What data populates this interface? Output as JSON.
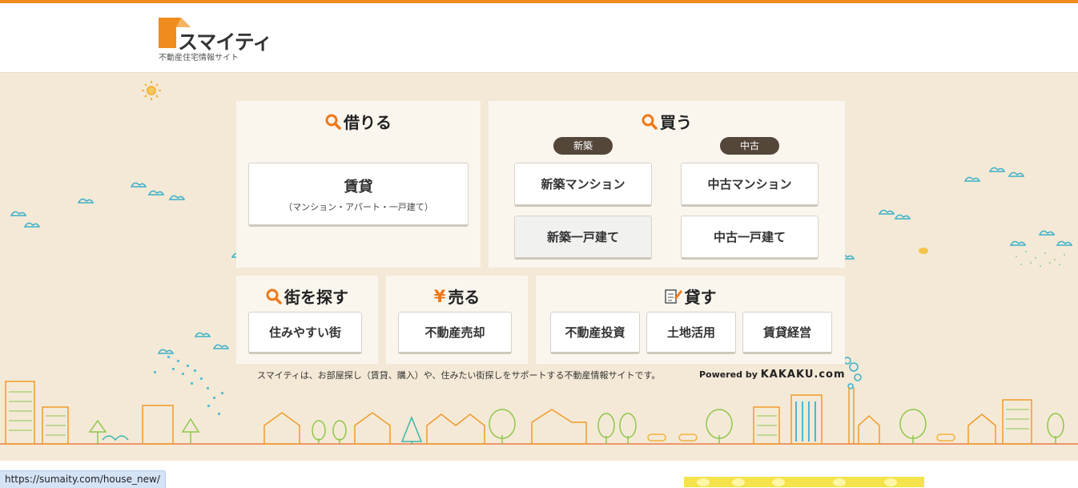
{
  "header": {
    "logo_text": "スマイティ",
    "logo_sub": "不動産住宅情報サイト"
  },
  "rent": {
    "title": "借りる",
    "main_label": "賃貸",
    "main_sub": "（マンション・アパート・一戸建て）"
  },
  "buy": {
    "title": "買う",
    "new_badge": "新築",
    "used_badge": "中古",
    "buttons": [
      "新築マンション",
      "中古マンション",
      "新築一戸建て",
      "中古一戸建て"
    ]
  },
  "town": {
    "title": "街を探す",
    "button": "住みやすい街"
  },
  "sell": {
    "title": "売る",
    "button": "不動産売却"
  },
  "lend": {
    "title": "貸す",
    "buttons": [
      "不動産投資",
      "土地活用",
      "賃貸経営"
    ]
  },
  "footer": {
    "description": "スマイティは、お部屋探し（賃貸、購入）や、住みたい街探しをサポートする不動産情報サイトです。",
    "powered_by": "Powered by",
    "powered_brand": "KAKAKU.com"
  },
  "status_url": "https://sumaity.com/house_new/",
  "colors": {
    "accent": "#f08c1e",
    "hero_bg": "#f4e9d6",
    "badge": "#55463a"
  }
}
